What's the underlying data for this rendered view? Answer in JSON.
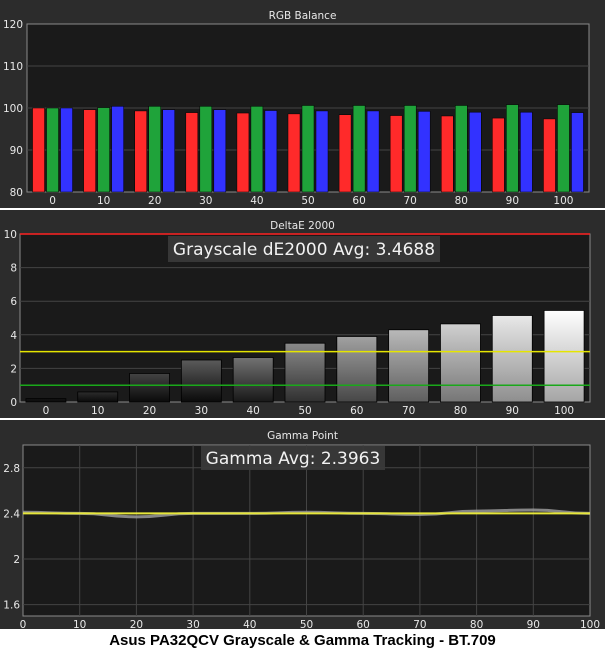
{
  "caption": "Asus PA32QCV Grayscale & Gamma Tracking - BT.709",
  "colors": {
    "panel_bg": "#2c2c2c",
    "plot_bg": "#1a1a1a",
    "grid": "#444444",
    "text": "#e8e8e8",
    "red": "#ff2a2a",
    "green": "#1fa33a",
    "blue": "#3232ff",
    "yellow": "#e6e63a",
    "limit_red": "#ff2222",
    "limit_yellow": "#e5e500",
    "limit_green": "#1aa81a"
  },
  "chart_data": [
    {
      "type": "bar",
      "title": "RGB Balance",
      "categories": [
        "0",
        "10",
        "20",
        "30",
        "40",
        "50",
        "60",
        "70",
        "80",
        "90",
        "100"
      ],
      "ylim": [
        80,
        120
      ],
      "yticks": [
        "120",
        "110",
        "100",
        "90",
        "80"
      ],
      "grid": true,
      "series": [
        {
          "color": "#ff2a2a",
          "values": [
            100.0,
            99.6,
            99.3,
            98.9,
            98.8,
            98.6,
            98.4,
            98.2,
            98.1,
            97.6,
            97.4
          ]
        },
        {
          "color": "#1fa33a",
          "values": [
            100.0,
            100.1,
            100.4,
            100.4,
            100.4,
            100.6,
            100.6,
            100.6,
            100.6,
            100.8,
            100.8
          ]
        },
        {
          "color": "#3232ff",
          "values": [
            100.0,
            100.4,
            99.6,
            99.6,
            99.4,
            99.3,
            99.3,
            99.2,
            99.0,
            99.0,
            98.9
          ]
        }
      ]
    },
    {
      "type": "bar",
      "title": "DeltaE 2000",
      "annotation": "Grayscale dE2000 Avg: 3.4688",
      "categories": [
        "0",
        "10",
        "20",
        "30",
        "40",
        "50",
        "60",
        "70",
        "80",
        "90",
        "100"
      ],
      "values": [
        0.2,
        0.6,
        1.7,
        2.5,
        2.65,
        3.5,
        3.9,
        4.3,
        4.65,
        5.15,
        5.45
      ],
      "ylim": [
        0,
        10
      ],
      "yticks": [
        "10",
        "8",
        "6",
        "4",
        "2",
        "0"
      ],
      "reference_lines": [
        {
          "value": 10,
          "color": "#ff2222"
        },
        {
          "value": 3,
          "color": "#e5e500"
        },
        {
          "value": 1,
          "color": "#1aa81a"
        }
      ],
      "grid": true
    },
    {
      "type": "line",
      "title": "Gamma Point",
      "annotation": "Gamma Avg: 2.3963",
      "x": [
        0,
        10,
        20,
        30,
        40,
        50,
        60,
        70,
        80,
        90,
        100
      ],
      "xticks": [
        "0",
        "10",
        "20",
        "30",
        "40",
        "50",
        "60",
        "70",
        "80",
        "90",
        "100"
      ],
      "ylim": [
        1.5,
        3.0
      ],
      "yticks": [
        "2.8",
        "2.4",
        "2",
        "1.6"
      ],
      "grid": true,
      "series": [
        {
          "color": "#e6e63a",
          "values": [
            2.4,
            2.4,
            2.4,
            2.4,
            2.4,
            2.4,
            2.4,
            2.4,
            2.4,
            2.4,
            2.4
          ]
        },
        {
          "color": "#9a9a9a",
          "values": [
            2.41,
            2.4,
            2.37,
            2.4,
            2.4,
            2.41,
            2.4,
            2.39,
            2.42,
            2.43,
            2.4
          ]
        }
      ]
    }
  ]
}
